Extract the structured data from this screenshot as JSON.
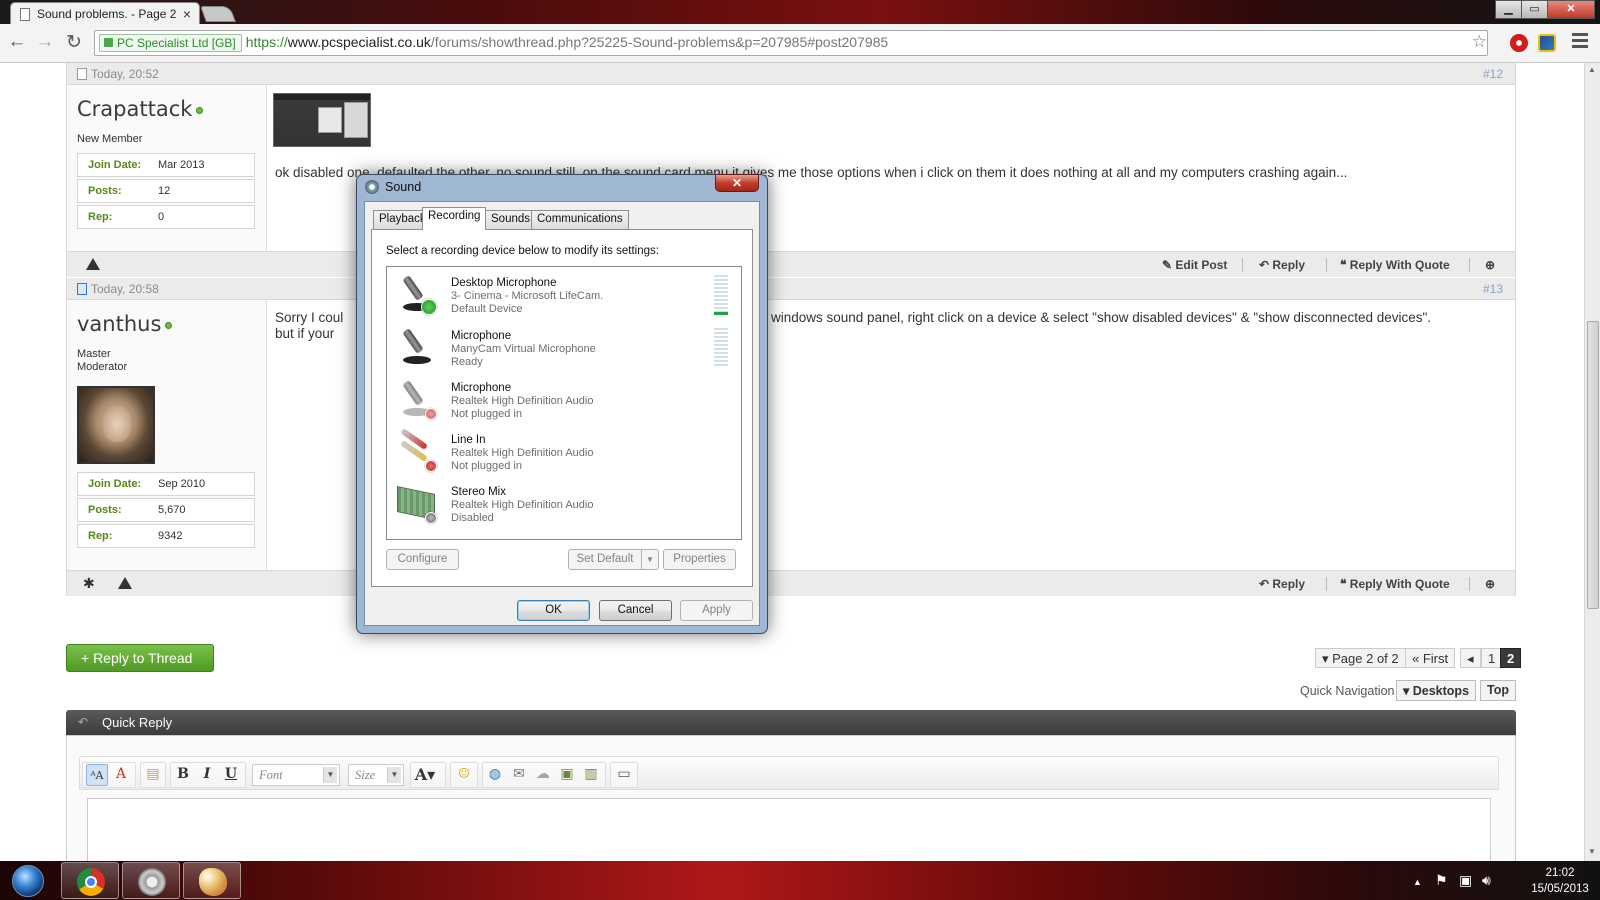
{
  "browser": {
    "tab_title": "Sound problems. - Page 2",
    "tab_close": "×",
    "window_controls": {
      "minimize": "▁",
      "maximize": "▭",
      "close": "✕"
    },
    "nav": {
      "back": "←",
      "forward": "→",
      "reload": "↻"
    },
    "ev_badge": "PC Specialist Ltd [GB]",
    "url_scheme": "https://",
    "url_host": "www.pcspecialist.co.uk",
    "url_path": "/forums/showthread.php?25225-Sound-problems&p=207985#post207985",
    "bookmark_star": "☆"
  },
  "posts": [
    {
      "time": "Today, 20:52",
      "number": "#12",
      "username": "Crapattack",
      "rank": "New Member",
      "stats": [
        {
          "key": "Join Date:",
          "value": "Mar 2013"
        },
        {
          "key": "Posts:",
          "value": "12"
        },
        {
          "key": "Rep:",
          "value": "0"
        }
      ],
      "body_line1": "ok disabled one, defaulted the other, no sound still, on the sound card menu it gives me those options when i click on them it does nothing at all and my computers crashing again...",
      "actions": {
        "edit": "Edit Post",
        "reply": "Reply",
        "quote": "Reply With Quote",
        "multi": "⊕"
      }
    },
    {
      "time": "Today, 20:58",
      "number": "#13",
      "username": "vanthus",
      "rank_line1": "Master",
      "rank_line2": "Moderator",
      "stats": [
        {
          "key": "Join Date:",
          "value": "Sep 2010"
        },
        {
          "key": "Posts:",
          "value": "5,670"
        },
        {
          "key": "Rep:",
          "value": "9342"
        }
      ],
      "body_line1_left": "Sorry I coul",
      "body_line1_right": "windows sound panel, right click on a device & select \"show disabled devices\" & \"show disconnected devices\".",
      "body_line2_left": "but if your",
      "actions": {
        "reply": "Reply",
        "quote": "Reply With Quote",
        "multi": "⊕"
      }
    }
  ],
  "sound_dialog": {
    "title": "Sound",
    "close_label": "✕",
    "tabs": [
      "Playback",
      "Recording",
      "Sounds",
      "Communications"
    ],
    "active_tab": "Recording",
    "instruction": "Select a recording device below to modify its settings:",
    "devices": [
      {
        "name": "Desktop Microphone",
        "desc": "3- Cinema - Microsoft LifeCam.",
        "status": "Default Device",
        "icon": "microphone-icon",
        "badge": "ok",
        "meter": 0.08
      },
      {
        "name": "Microphone",
        "desc": "ManyCam Virtual Microphone",
        "status": "Ready",
        "icon": "microphone-icon",
        "badge": "none",
        "meter": 0.0
      },
      {
        "name": "Microphone",
        "desc": "Realtek High Definition Audio",
        "status": "Not plugged in",
        "icon": "microphone-icon",
        "badge": "red"
      },
      {
        "name": "Line In",
        "desc": "Realtek High Definition Audio",
        "status": "Not plugged in",
        "icon": "line-in-jack-icon",
        "badge": "red"
      },
      {
        "name": "Stereo Mix",
        "desc": "Realtek High Definition Audio",
        "status": "Disabled",
        "icon": "sound-card-icon",
        "badge": "gray"
      }
    ],
    "buttons": {
      "configure": "Configure",
      "set_default": "Set Default",
      "properties": "Properties",
      "ok": "OK",
      "cancel": "Cancel",
      "apply": "Apply"
    }
  },
  "thread_controls": {
    "reply_to_thread": "+ Reply to Thread",
    "page_of": "Page 2 of 2",
    "first": "First",
    "pages": [
      "1",
      "2"
    ],
    "current_page": "2",
    "quick_navigation": "Quick Navigation",
    "desktops": "Desktops",
    "top": "Top"
  },
  "quick_reply": {
    "title": "Quick Reply",
    "font_placeholder": "Font",
    "size_placeholder": "Size"
  },
  "taskbar": {
    "time": "21:02",
    "date": "15/05/2013"
  }
}
